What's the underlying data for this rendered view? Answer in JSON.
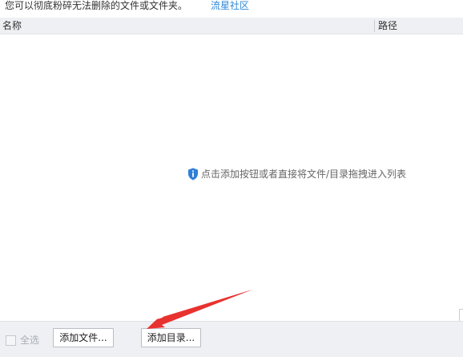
{
  "header": {
    "description": "您可以彻底粉碎无法删除的文件或文件夹。",
    "community_link": "流星社区"
  },
  "list": {
    "columns": [
      "名称",
      "路径"
    ],
    "empty_hint": "点击添加按钮或者直接将文件/目录拖拽进入列表",
    "hint_icon": "shield-info-icon"
  },
  "footer": {
    "select_all_label": "全选",
    "select_all_checked": false,
    "add_file_label": "添加文件...",
    "add_dir_label": "添加目录..."
  },
  "colors": {
    "link": "#2e87d8",
    "hint_icon": "#2f7fd6",
    "annotation_arrow": "#e8322f",
    "header_bg": "#eef0f3"
  }
}
